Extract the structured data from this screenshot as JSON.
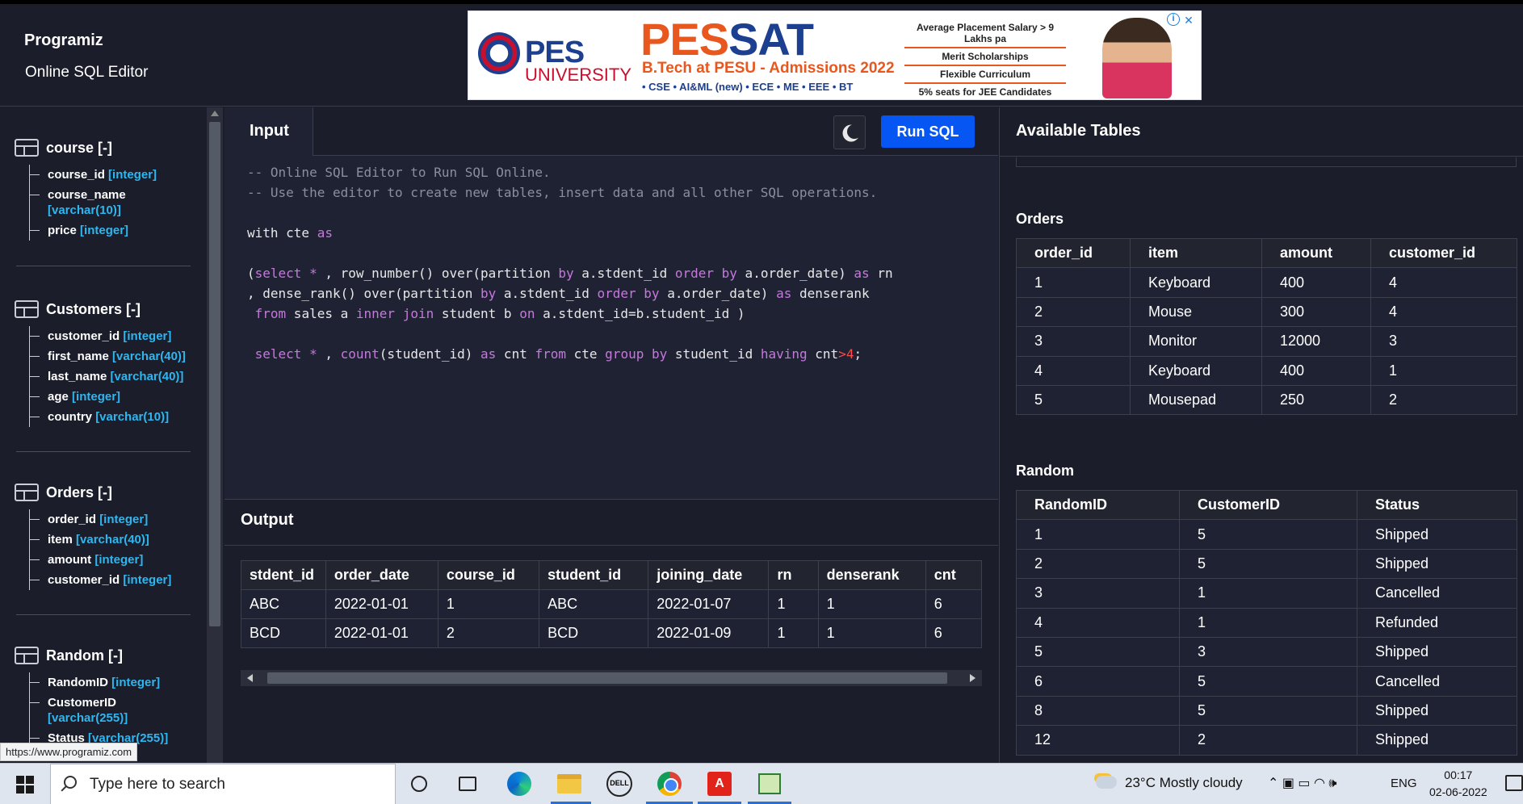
{
  "header": {
    "logo": "Programiz",
    "subtitle": "Online SQL Editor"
  },
  "ad": {
    "brand_pes": "PES",
    "brand_univ": "UNIVERSITY",
    "pessat_a": "PES",
    "pessat_b": "SAT",
    "program": "B.Tech at PESU - Admissions 2022",
    "tags": "• CSE  • AI&ML (new)  • ECE  • ME  • EEE  • BT",
    "points": [
      "Average Placement Salary > 9 Lakhs pa",
      "Merit Scholarships",
      "Flexible Curriculum",
      "5% seats for JEE Candidates"
    ],
    "close_glyph": "✕",
    "info_glyph": "i"
  },
  "sidebar": {
    "tables": [
      {
        "name": "course [-]",
        "columns": [
          {
            "name": "course_id",
            "type": "[integer]"
          },
          {
            "name": "course_name",
            "type": "[varchar(10)]"
          },
          {
            "name": "price",
            "type": "[integer]"
          }
        ]
      },
      {
        "name": "Customers [-]",
        "columns": [
          {
            "name": "customer_id",
            "type": "[integer]"
          },
          {
            "name": "first_name",
            "type": "[varchar(40)]"
          },
          {
            "name": "last_name",
            "type": "[varchar(40)]"
          },
          {
            "name": "age",
            "type": "[integer]"
          },
          {
            "name": "country",
            "type": "[varchar(10)]"
          }
        ]
      },
      {
        "name": "Orders [-]",
        "columns": [
          {
            "name": "order_id",
            "type": "[integer]"
          },
          {
            "name": "item",
            "type": "[varchar(40)]"
          },
          {
            "name": "amount",
            "type": "[integer]"
          },
          {
            "name": "customer_id",
            "type": "[integer]"
          }
        ]
      },
      {
        "name": "Random [-]",
        "columns": [
          {
            "name": "RandomID",
            "type": "[integer]"
          },
          {
            "name": "CustomerID",
            "type": "[varchar(255)]"
          },
          {
            "name": "Status",
            "type": "[varchar(255)]"
          }
        ]
      }
    ],
    "status_url": "https://www.programiz.com"
  },
  "input": {
    "tab_label": "Input",
    "run_label": "Run SQL",
    "code": {
      "comment1": "-- Online SQL Editor to Run SQL Online.",
      "comment2": "-- Use the editor to create new tables, insert data and all other SQL operations.",
      "line3_a": "with cte ",
      "line3_b": "as",
      "l5_1": "(",
      "l5_2": "select",
      "l5_3": " ",
      "l5_4": "*",
      "l5_5": " , row_number() over(partition ",
      "l5_6": "by",
      "l5_7": " a.stdent_id ",
      "l5_8": "order",
      "l5_9": " ",
      "l5_10": "by",
      "l5_11": " a.order_date) ",
      "l5_12": "as",
      "l5_13": " rn",
      "l6_1": ", dense_rank() over(partition ",
      "l6_2": "by",
      "l6_3": " a.stdent_id ",
      "l6_4": "order",
      "l6_5": " ",
      "l6_6": "by",
      "l6_7": " a.order_date) ",
      "l6_8": "as",
      "l6_9": " denserank",
      "l7_1": " ",
      "l7_2": "from",
      "l7_3": " sales a ",
      "l7_4": "inner",
      "l7_5": " ",
      "l7_6": "join",
      "l7_7": " student b ",
      "l7_8": "on",
      "l7_9": " a.stdent_id=b.student_id )",
      "l9_1": " ",
      "l9_2": "select",
      "l9_3": " ",
      "l9_4": "*",
      "l9_5": " , ",
      "l9_6": "count",
      "l9_7": "(student_id) ",
      "l9_8": "as",
      "l9_9": " cnt ",
      "l9_10": "from",
      "l9_11": " cte ",
      "l9_12": "group",
      "l9_13": " ",
      "l9_14": "by",
      "l9_15": " student_id ",
      "l9_16": "having",
      "l9_17": " cnt",
      "l9_18": ">",
      "l9_19": "4",
      "l9_20": ";"
    }
  },
  "output": {
    "title": "Output",
    "columns": [
      "stdent_id",
      "order_date",
      "course_id",
      "student_id",
      "joining_date",
      "rn",
      "denserank",
      "cnt"
    ],
    "rows": [
      [
        "ABC",
        "2022-01-01",
        "1",
        "ABC",
        "2022-01-07",
        "1",
        "1",
        "6"
      ],
      [
        "BCD",
        "2022-01-01",
        "2",
        "BCD",
        "2022-01-09",
        "1",
        "1",
        "6"
      ]
    ]
  },
  "available": {
    "title": "Available Tables",
    "orders": {
      "title": "Orders",
      "columns": [
        "order_id",
        "item",
        "amount",
        "customer_id"
      ],
      "rows": [
        [
          "1",
          "Keyboard",
          "400",
          "4"
        ],
        [
          "2",
          "Mouse",
          "300",
          "4"
        ],
        [
          "3",
          "Monitor",
          "12000",
          "3"
        ],
        [
          "4",
          "Keyboard",
          "400",
          "1"
        ],
        [
          "5",
          "Mousepad",
          "250",
          "2"
        ]
      ]
    },
    "random": {
      "title": "Random",
      "columns": [
        "RandomID",
        "CustomerID",
        "Status"
      ],
      "rows": [
        [
          "1",
          "5",
          "Shipped"
        ],
        [
          "2",
          "5",
          "Shipped"
        ],
        [
          "3",
          "1",
          "Cancelled"
        ],
        [
          "4",
          "1",
          "Refunded"
        ],
        [
          "5",
          "3",
          "Shipped"
        ],
        [
          "6",
          "5",
          "Cancelled"
        ],
        [
          "8",
          "5",
          "Shipped"
        ],
        [
          "12",
          "2",
          "Shipped"
        ]
      ]
    }
  },
  "taskbar": {
    "search_placeholder": "Type here to search",
    "dell_text": "DELL",
    "acrobat_glyph": "A",
    "weather": "23°C  Mostly cloudy",
    "tray_glyphs": "⌃  ▣  ▭  ◠  🕪",
    "lang": "ENG",
    "time": "00:17",
    "date": "02-06-2022"
  }
}
